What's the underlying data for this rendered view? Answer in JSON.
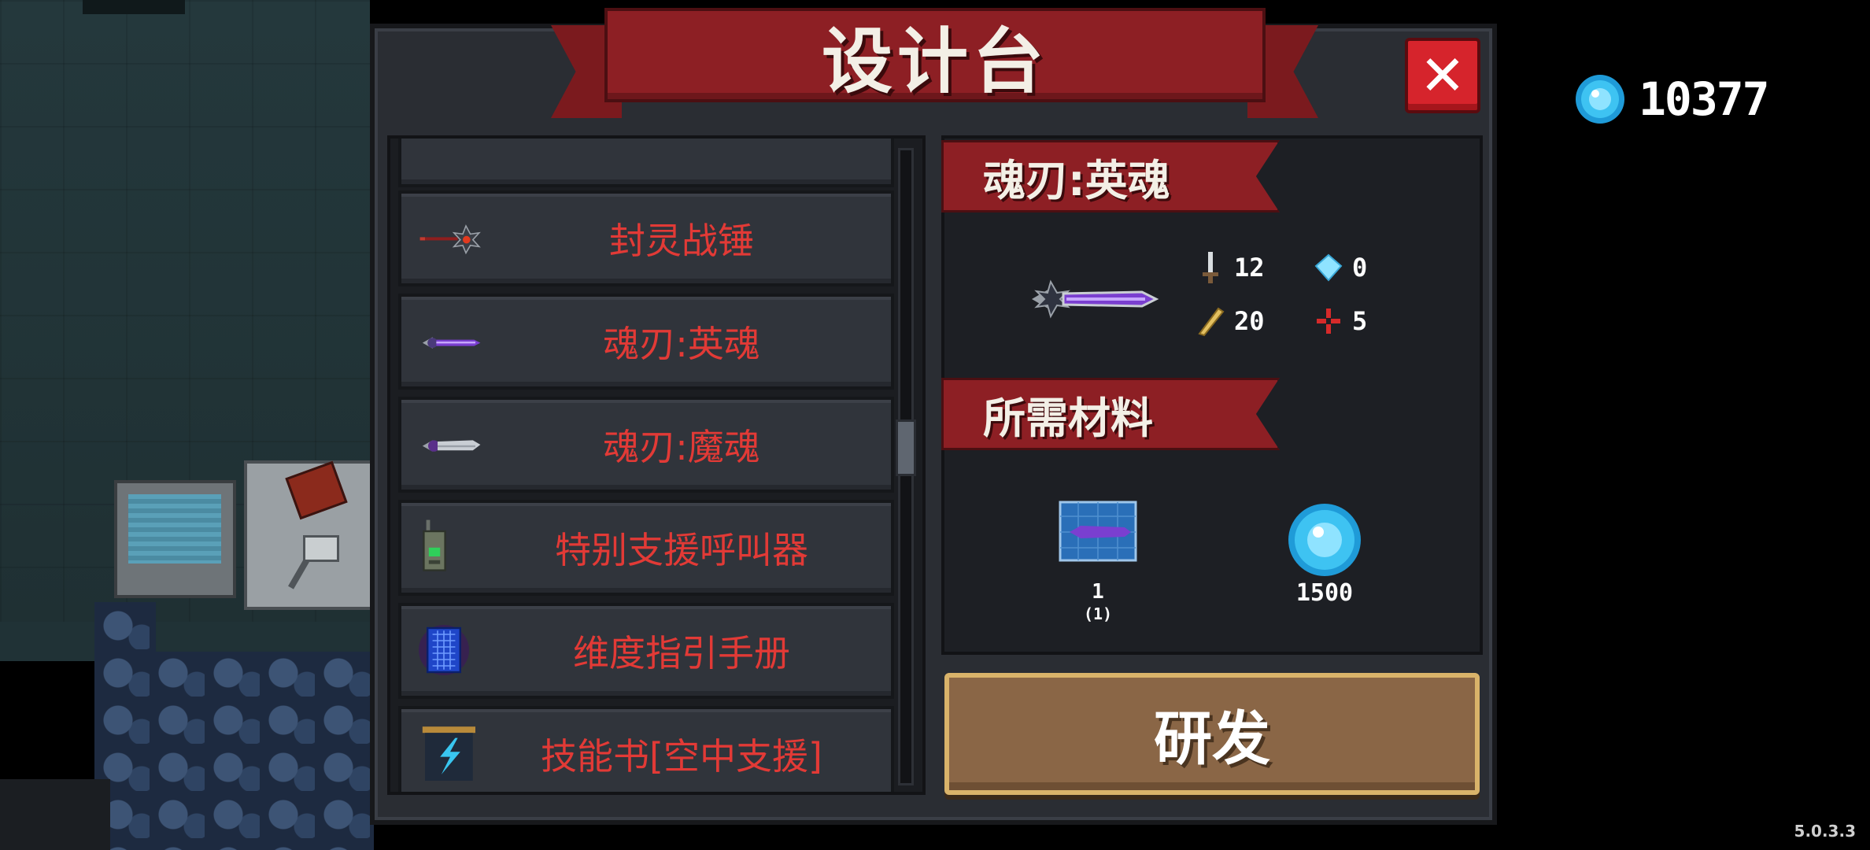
{
  "title": "设计台",
  "close_label": "✕",
  "currency": {
    "amount": "10377",
    "icon": "gem-icon"
  },
  "list": {
    "items": [
      {
        "label": "",
        "icon": ""
      },
      {
        "label": "封灵战锤",
        "icon": "mace-icon"
      },
      {
        "label": "魂刃:英魂",
        "icon": "soul-blade-icon"
      },
      {
        "label": "魂刃:魔魂",
        "icon": "demon-blade-icon"
      },
      {
        "label": "特别支援呼叫器",
        "icon": "walkie-talkie-icon"
      },
      {
        "label": "维度指引手册",
        "icon": "dimension-book-icon"
      },
      {
        "label": "技能书[空中支援]",
        "icon": "skill-book-icon"
      }
    ]
  },
  "detail": {
    "name": "魂刃:英魂",
    "stats": {
      "damage": "12",
      "energy": "0",
      "crit": "20",
      "spread": "5"
    },
    "materials_label": "所需材料",
    "materials": [
      {
        "icon": "blueprint-icon",
        "count": "1",
        "sub": "(1)"
      },
      {
        "icon": "gem-icon",
        "count": "1500"
      }
    ],
    "research_label": "研发"
  },
  "version": "5.0.3.3",
  "colors": {
    "accent_red": "#8d1f24",
    "list_text": "#e23a36",
    "button_brown": "#8a6646",
    "gem_blue": "#3ec3f2"
  }
}
